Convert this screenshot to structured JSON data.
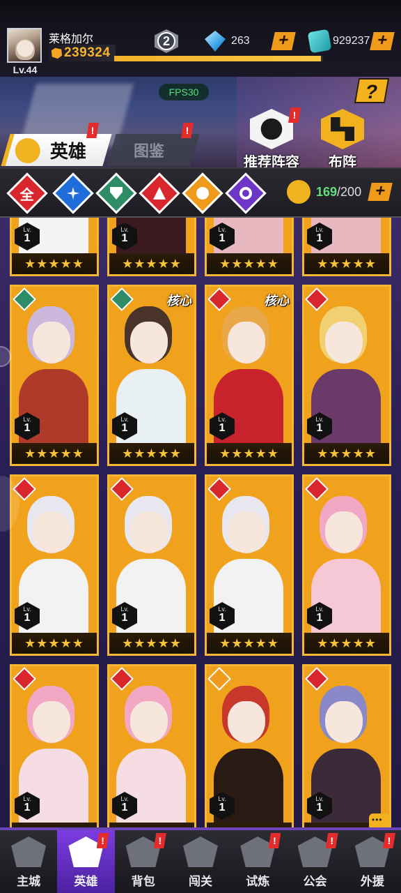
{
  "player": {
    "name": "莱格加尔",
    "level": "Lv.44",
    "power": "239324",
    "exp_fraction": 0.99,
    "rank": "2"
  },
  "resources": {
    "gems": "263",
    "coins": "929237",
    "plus": "+"
  },
  "fps": "FPS30",
  "help": "?",
  "tabs": {
    "heroes": "英雄",
    "gallery": "图鉴"
  },
  "features": {
    "recommended": "推荐阵容",
    "formation": "布阵"
  },
  "badges": {
    "alert": "!"
  },
  "filters": {
    "all": "全"
  },
  "hero_count": {
    "current": "169",
    "max": "/200"
  },
  "cards": [
    {
      "lv_label": "Lv.",
      "level": "1",
      "stars": "★★★★★",
      "core": "",
      "hair": "#ece8f0",
      "cloth": "#f4f4f4",
      "element": "red"
    },
    {
      "lv_label": "Lv.",
      "level": "1",
      "stars": "★★★★★",
      "core": "",
      "hair": "#2a1a18",
      "cloth": "#3a1a20",
      "element": "red"
    },
    {
      "lv_label": "Lv.",
      "level": "1",
      "stars": "★★★★★",
      "core": "",
      "hair": "#d84a78",
      "cloth": "#e8b8c0",
      "element": "red"
    },
    {
      "lv_label": "Lv.",
      "level": "1",
      "stars": "★★★★★",
      "core": "",
      "hair": "#d84a78",
      "cloth": "#e8b8c0",
      "element": "red"
    },
    {
      "lv_label": "Lv.",
      "level": "1",
      "stars": "★★★★★",
      "core": "",
      "hair": "#cbb8dc",
      "cloth": "#b03a2a",
      "element": "green"
    },
    {
      "lv_label": "Lv.",
      "level": "1",
      "stars": "★★★★★",
      "core": "核心",
      "hair": "#4a3328",
      "cloth": "#e9f0f4",
      "element": "green"
    },
    {
      "lv_label": "Lv.",
      "level": "1",
      "stars": "★★★★★",
      "core": "核心",
      "hair": "#e8a84a",
      "cloth": "#c8232c",
      "element": "red"
    },
    {
      "lv_label": "Lv.",
      "level": "1",
      "stars": "★★★★★",
      "core": "",
      "hair": "#f0d070",
      "cloth": "#6a3a6a",
      "element": "red"
    },
    {
      "lv_label": "Lv.",
      "level": "1",
      "stars": "★★★★★",
      "core": "",
      "hair": "#e8e6ee",
      "cloth": "#f2f2f2",
      "element": "red"
    },
    {
      "lv_label": "Lv.",
      "level": "1",
      "stars": "★★★★★",
      "core": "",
      "hair": "#e8e6ee",
      "cloth": "#f2f2f2",
      "element": "red"
    },
    {
      "lv_label": "Lv.",
      "level": "1",
      "stars": "★★★★★",
      "core": "",
      "hair": "#e8e6ee",
      "cloth": "#f2f2f2",
      "element": "red"
    },
    {
      "lv_label": "Lv.",
      "level": "1",
      "stars": "★★★★★",
      "core": "",
      "hair": "#f2a8c4",
      "cloth": "#f6c8d6",
      "element": "red"
    },
    {
      "lv_label": "Lv.",
      "level": "1",
      "stars": "★★★★★",
      "core": "",
      "hair": "#f2a8c4",
      "cloth": "#f6dde4",
      "element": "red"
    },
    {
      "lv_label": "Lv.",
      "level": "1",
      "stars": "★★★★★",
      "core": "",
      "hair": "#f2a8c4",
      "cloth": "#f6dde4",
      "element": "red"
    },
    {
      "lv_label": "Lv.",
      "level": "1",
      "stars": "★★★★★",
      "core": "",
      "hair": "#c8382a",
      "cloth": "#2a1a14",
      "element": "orange"
    },
    {
      "lv_label": "Lv.",
      "level": "1",
      "stars": "★★★★★",
      "core": "",
      "hair": "#8a88c8",
      "cloth": "#3a2a3a",
      "element": "red"
    }
  ],
  "nav": [
    {
      "label": "主城",
      "icon": "castle-icon",
      "active": false,
      "alert": false
    },
    {
      "label": "英雄",
      "icon": "hero-helmet-icon",
      "active": true,
      "alert": true
    },
    {
      "label": "背包",
      "icon": "backpack-icon",
      "active": false,
      "alert": true
    },
    {
      "label": "闯关",
      "icon": "wings-icon",
      "active": false,
      "alert": false
    },
    {
      "label": "试炼",
      "icon": "trial-shield-icon",
      "active": false,
      "alert": true
    },
    {
      "label": "公会",
      "icon": "guild-icon",
      "active": false,
      "alert": true
    },
    {
      "label": "外援",
      "icon": "support-icon",
      "active": false,
      "alert": true
    }
  ],
  "colors": {
    "accent": "#f1b21f",
    "active_nav": "#7c3ce0",
    "count_green": "#5fe07a"
  }
}
